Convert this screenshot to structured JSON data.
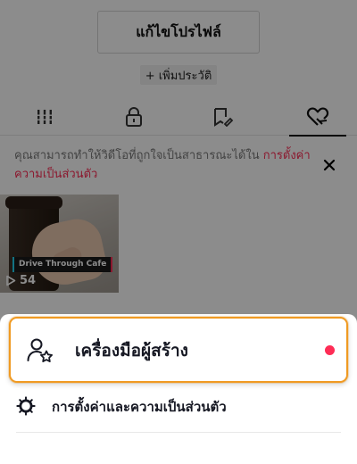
{
  "profile": {
    "edit_profile_label": "แก้ไขโปรไฟล์",
    "add_bio_label": "+ เพิ่มประวัติ"
  },
  "tabs": [
    {
      "icon": "grid-icon",
      "active": false
    },
    {
      "icon": "lock-icon",
      "active": false
    },
    {
      "icon": "bookmark-icon",
      "active": false
    },
    {
      "icon": "liked-videos-icon",
      "active": true
    }
  ],
  "notice": {
    "text": "คุณสามารถทำให้วิดีโอที่ถูกใจเป็นสาธารณะได้ใน ",
    "link_text": "การตั้งค่าความเป็นส่วนตัว",
    "close_icon": "close-icon"
  },
  "videos": [
    {
      "caption": "Drive Through Cafe",
      "views": "54",
      "play_icon": "play-icon"
    }
  ],
  "menu": {
    "creator_tools_label": "เครื่องมือผู้สร้าง",
    "creator_tools_icon": "creator-tools-icon",
    "creator_tools_badge_color": "#fe2c55",
    "settings_label": "การตั้งค่าและความเป็นส่วนตัว",
    "settings_icon": "settings-gear-icon"
  },
  "colors": {
    "accent": "#fe2c55",
    "highlight_border": "#f09a22"
  }
}
